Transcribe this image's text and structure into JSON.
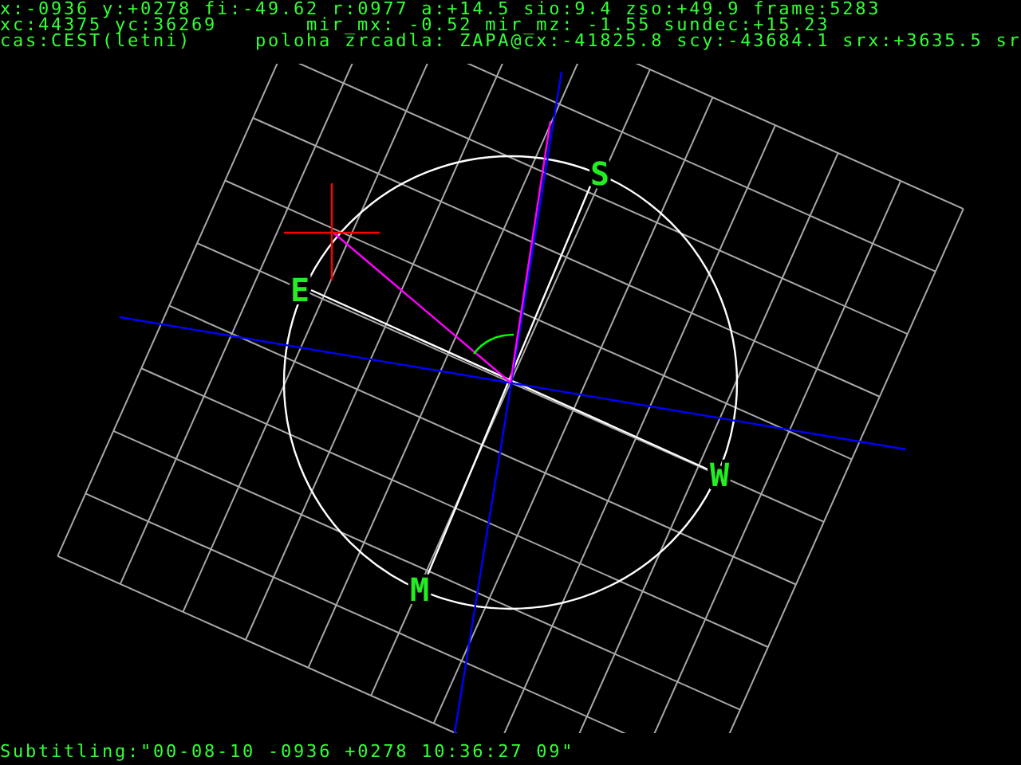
{
  "status_lines": [
    {
      "left": "x:-0936 y:+0278 fi:-49.62 r:0977 a:+14.5 sio:9.4 zso:+49.9 frame:5283"
    },
    {
      "left": "xc:44375 yc:36269",
      "right": "mir_mx: -0.52 mir_mz: -1.55 sundec:+15.23"
    },
    {
      "left": "cas:CEST(letni)",
      "right": "poloha zrcadla: ZAPA@cx:-41825.8 scy:-43684.1 srx:+3635.5 sr"
    }
  ],
  "compass_labels": [
    {
      "text": "S",
      "kind": "s"
    },
    {
      "text": "E",
      "kind": "e"
    },
    {
      "text": "W",
      "kind": "w"
    },
    {
      "text": "M",
      "kind": "m"
    }
  ],
  "subtitle": "Subtitling:\"00-08-10 -0936 +0278 10:36:27 09\""
}
